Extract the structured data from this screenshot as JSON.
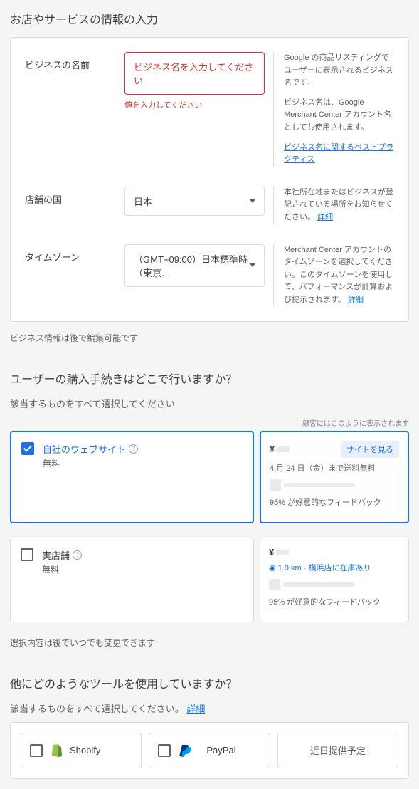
{
  "section1": {
    "heading": "お店やサービスの情報の入力",
    "fields": {
      "businessName": {
        "label": "ビジネスの名前",
        "placeholder": "ビジネス名を入力してください",
        "error": "値を入力してください",
        "help1": "Google の商品リスティングでユーザーに表示されるビジネス名です。",
        "help2": "ビジネス名は、Google Merchant Center アカウント名としても使用されます。",
        "helpLink": "ビジネス名に関するベストプラクティス"
      },
      "country": {
        "label": "店舗の国",
        "value": "日本",
        "help": "本社所在地またはビジネスが登記されている場所をお知らせください。",
        "helpLink": "詳細"
      },
      "timezone": {
        "label": "タイムゾーン",
        "value": "（GMT+09:00）日本標準時（東京…",
        "help": "Merchant Center アカウントのタイムゾーンを選択してください。このタイムゾーンを使用して、パフォーマンスが計算および提示されます。",
        "helpLink": "詳細"
      }
    },
    "note": "ビジネス情報は後で編集可能です"
  },
  "section2": {
    "heading": "ユーザーの購入手続きはどこで行いますか？",
    "subtitle": "該当するものをすべて選択してください",
    "rightNote": "顧客にはこのように表示されます",
    "options": {
      "website": {
        "title": "自社のウェブサイト",
        "sub": "無料",
        "checked": true,
        "preview": {
          "yen": "¥",
          "button": "サイトを見る",
          "line1": "4 月 24 日（金）まで送料無料",
          "feedback": "95% が好意的なフィードバック"
        }
      },
      "store": {
        "title": "実店舗",
        "sub": "無料",
        "checked": false,
        "preview": {
          "yen": "¥",
          "line1": "1.9 km · 横浜店に在庫あり",
          "feedback": "95% が好意的なフィードバック"
        }
      }
    },
    "note": "選択内容は後でいつでも変更できます"
  },
  "section3": {
    "heading": "他にどのようなツールを使用していますか？",
    "subtitle": "該当するものをすべて選択してください。",
    "subtitleLink": "詳細",
    "tools": {
      "shopify": "Shopify",
      "paypal": "PayPal",
      "coming": "近日提供予定"
    }
  }
}
